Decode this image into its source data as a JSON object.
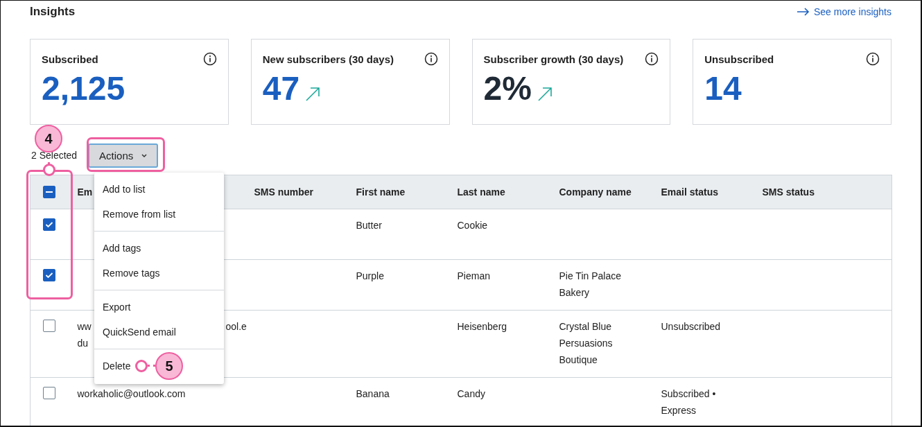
{
  "header": {
    "title": "Insights",
    "link": "See more insights"
  },
  "cards": [
    {
      "label": "Subscribed",
      "value": "2,125",
      "color": "#1a5fc0",
      "trend_up": false
    },
    {
      "label": "New subscribers (30 days)",
      "value": "47",
      "color": "#1a5fc0",
      "trend_up": true
    },
    {
      "label": "Subscriber growth (30 days)",
      "value": "2%",
      "color": "#1f2a36",
      "trend_up": true
    },
    {
      "label": "Unsubscribed",
      "value": "14",
      "color": "#1a5fc0",
      "trend_up": false
    }
  ],
  "toolbar": {
    "selected_count": "2 Selected",
    "actions": "Actions"
  },
  "table": {
    "header_checkbox": {
      "checked": true,
      "mixed": true
    },
    "columns": [
      "Em",
      "SMS number",
      "First name",
      "Last name",
      "Company name",
      "Email status",
      "SMS status"
    ],
    "rows": [
      {
        "checked": true,
        "email": [],
        "first": "Butter",
        "last": "Cookie",
        "company": "",
        "email_status": ""
      },
      {
        "checked": true,
        "email": [],
        "first": "Purple",
        "last": "Pieman",
        "company": "Pie Tin Palace Bakery",
        "email_status": ""
      },
      {
        "checked": false,
        "email": [
          [
            "ww",
            "ool.e"
          ],
          [
            "du"
          ]
        ],
        "first": "",
        "last": "Heisenberg",
        "company": "Crystal Blue Persuasions Boutique",
        "email_status": "Unsubscribed"
      },
      {
        "checked": false,
        "email": [
          [
            "workaholic@outlook.com"
          ]
        ],
        "first": "Banana",
        "last": "Candy",
        "company": "",
        "email_status": "Subscribed • Express"
      }
    ]
  },
  "menu": {
    "groups": [
      [
        "Add to list",
        "Remove from list"
      ],
      [
        "Add tags",
        "Remove tags"
      ],
      [
        "Export",
        "QuickSend email"
      ],
      [
        "Delete"
      ]
    ]
  },
  "annotations": [
    {
      "number": "4"
    },
    {
      "number": "5"
    }
  ]
}
